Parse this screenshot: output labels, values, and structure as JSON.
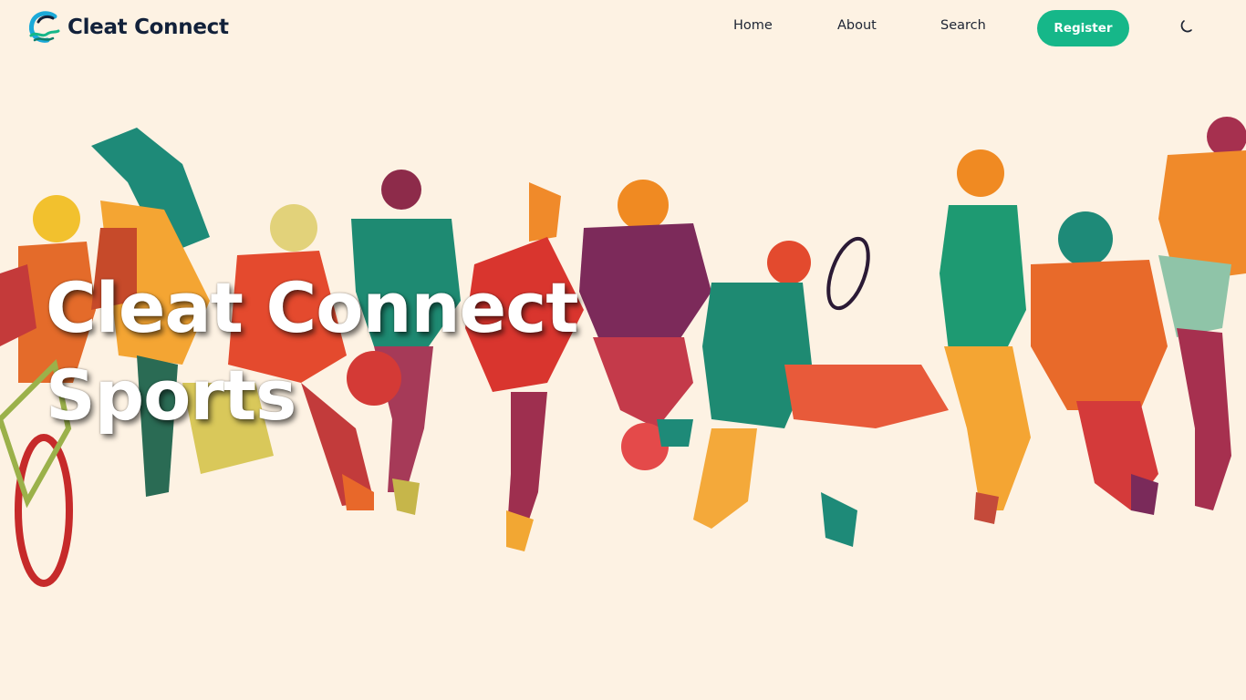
{
  "brand": {
    "name": "Cleat Connect",
    "logo_icon": "wave-c-logo-icon"
  },
  "nav": {
    "home_label": "Home",
    "about_label": "About",
    "search_label": "Search",
    "register_label": "Register",
    "theme_icon": "moon-icon"
  },
  "hero": {
    "title_line1": "Cleat Connect",
    "title_line2": "Sports"
  },
  "colors": {
    "background": "#fdf2e3",
    "accent": "#16b789",
    "brand_text": "#12213a"
  }
}
